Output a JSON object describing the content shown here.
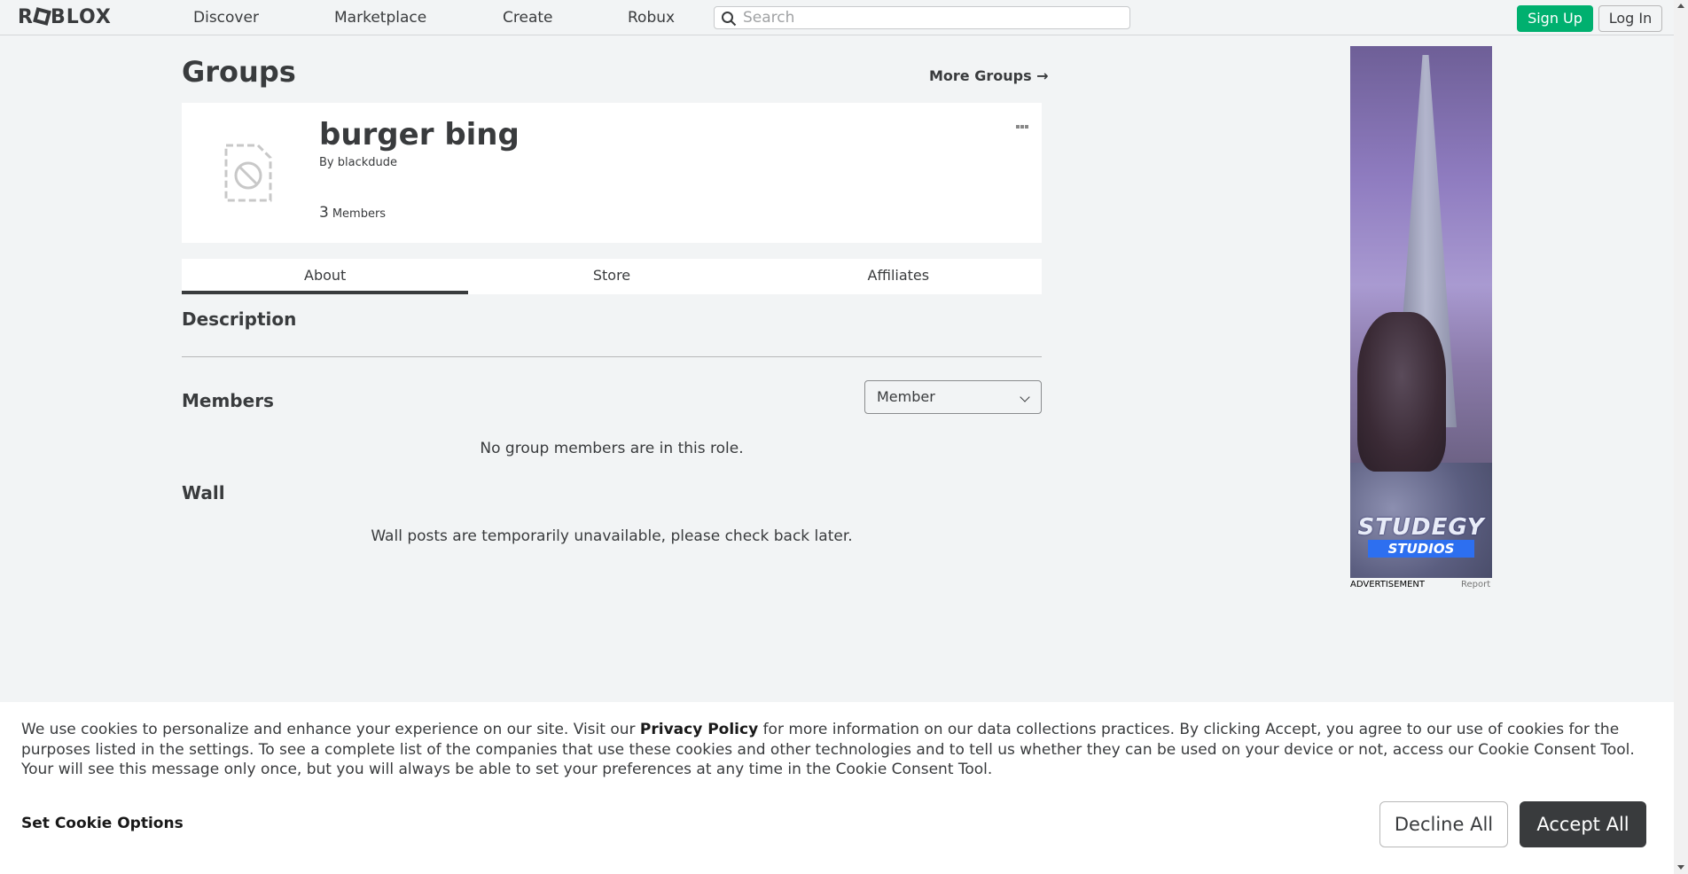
{
  "header": {
    "logo": "ROBLOX",
    "nav": [
      "Discover",
      "Marketplace",
      "Create",
      "Robux"
    ],
    "search_placeholder": "Search",
    "signup_label": "Sign Up",
    "login_label": "Log In"
  },
  "main": {
    "page_title": "Groups",
    "more_groups_label": "More Groups →",
    "group": {
      "name": "burger bing",
      "owner_prefix": "By",
      "owner_name": "blackdude",
      "member_count": "3",
      "member_label": "Members"
    },
    "tabs": [
      {
        "label": "About",
        "active": true
      },
      {
        "label": "Store",
        "active": false
      },
      {
        "label": "Affiliates",
        "active": false
      }
    ],
    "description_title": "Description",
    "members_title": "Members",
    "role_select_value": "Member",
    "members_empty": "No group members are in this role.",
    "wall_title": "Wall",
    "wall_message": "Wall posts are temporarily unavailable, please check back later."
  },
  "ad": {
    "brand": "STUDEGY",
    "brand_sub": "STUDIOS",
    "label": "ADVERTISEMENT",
    "report_label": "Report"
  },
  "cookie_banner": {
    "text_before": "We use cookies to personalize and enhance your experience on our site. Visit our ",
    "privacy_link": "Privacy Policy",
    "text_after": " for more information on our data collections practices. By clicking Accept, you agree to our use of cookies for the purposes listed in the settings. To see a complete list of the companies that use these cookies and other technologies and to tell us whether they can be used on your device or not, access our Cookie Consent Tool. Your will see this message only once, but you will always be able to set your preferences at any time in the Cookie Consent Tool.",
    "options_label": "Set Cookie Options",
    "decline_label": "Decline All",
    "accept_label": "Accept All"
  },
  "colors": {
    "accent_green": "#00b06f",
    "text_dark": "#393b3d",
    "background": "#f2f4f5"
  }
}
